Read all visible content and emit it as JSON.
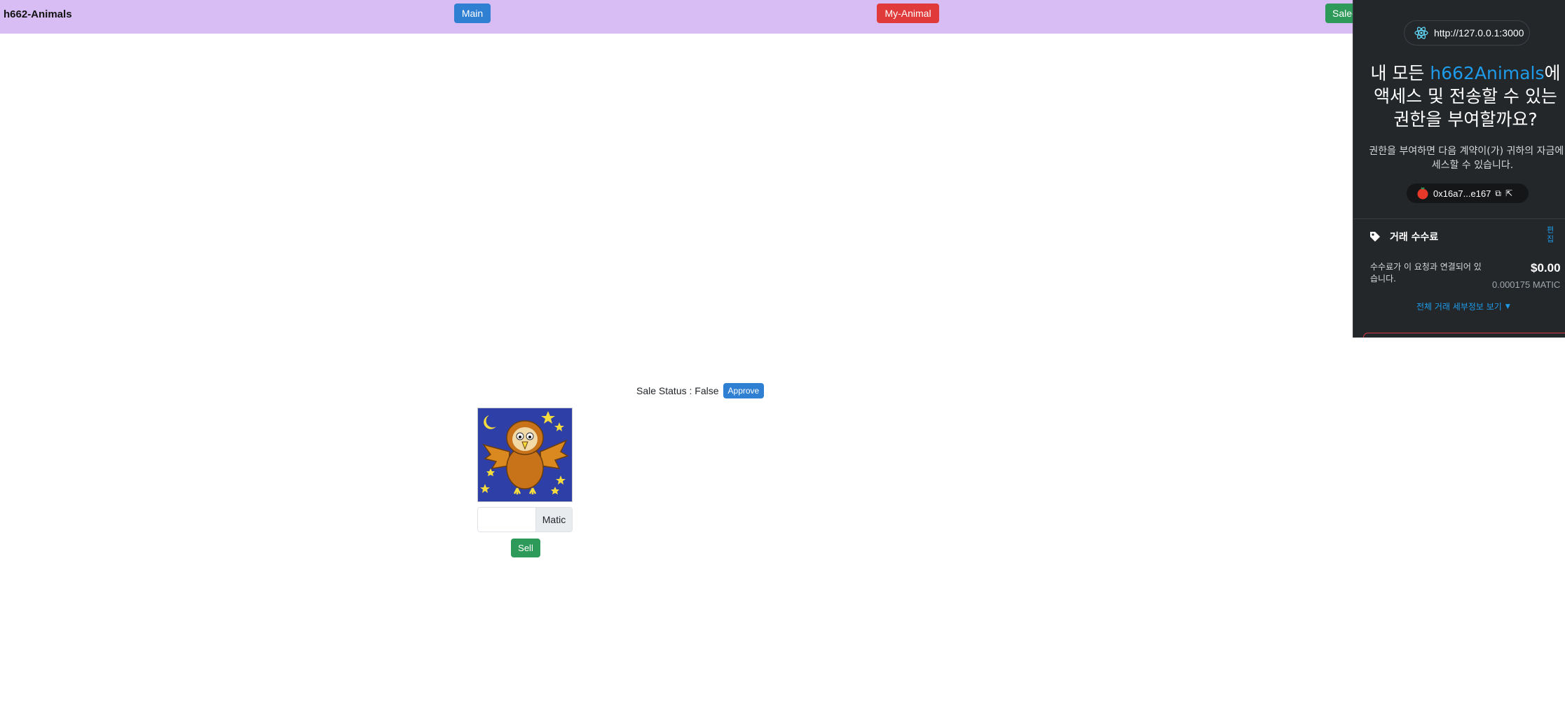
{
  "navbar": {
    "brand": "h662-Animals",
    "main_label": "Main",
    "my_animal_label": "My-Animal",
    "sale_label": "Sale-"
  },
  "sale": {
    "status_text": "Sale Status : False",
    "approve_label": "Approve",
    "price_placeholder": "",
    "currency_label": "Matic",
    "sell_label": "Sell",
    "image_icon": "owl-illustration"
  },
  "wallet": {
    "origin": "http://127.0.0.1:3000",
    "title_prefix": "내 모든 ",
    "title_accent": "h662Animals",
    "title_suffix_line1": "에",
    "title_line2": "액세스 및 전송할 수 있는",
    "title_line3": "권한을 부여할까요?",
    "description": "권한을 부여하면 다음 계약이(가) 귀하의 자금에 액세스할 수 있습니다.",
    "address": "0x16a7...e167",
    "fee_label": "거래 수수료",
    "edit_label": "편집",
    "fee_note": "수수료가 이 요청과 연결되어 있습니다.",
    "fee_fiat": "$0.00",
    "fee_native": "0.000175 MATIC",
    "details_label": "전체 거래 세부정보 보기",
    "accent_color": "#1e9be9"
  }
}
